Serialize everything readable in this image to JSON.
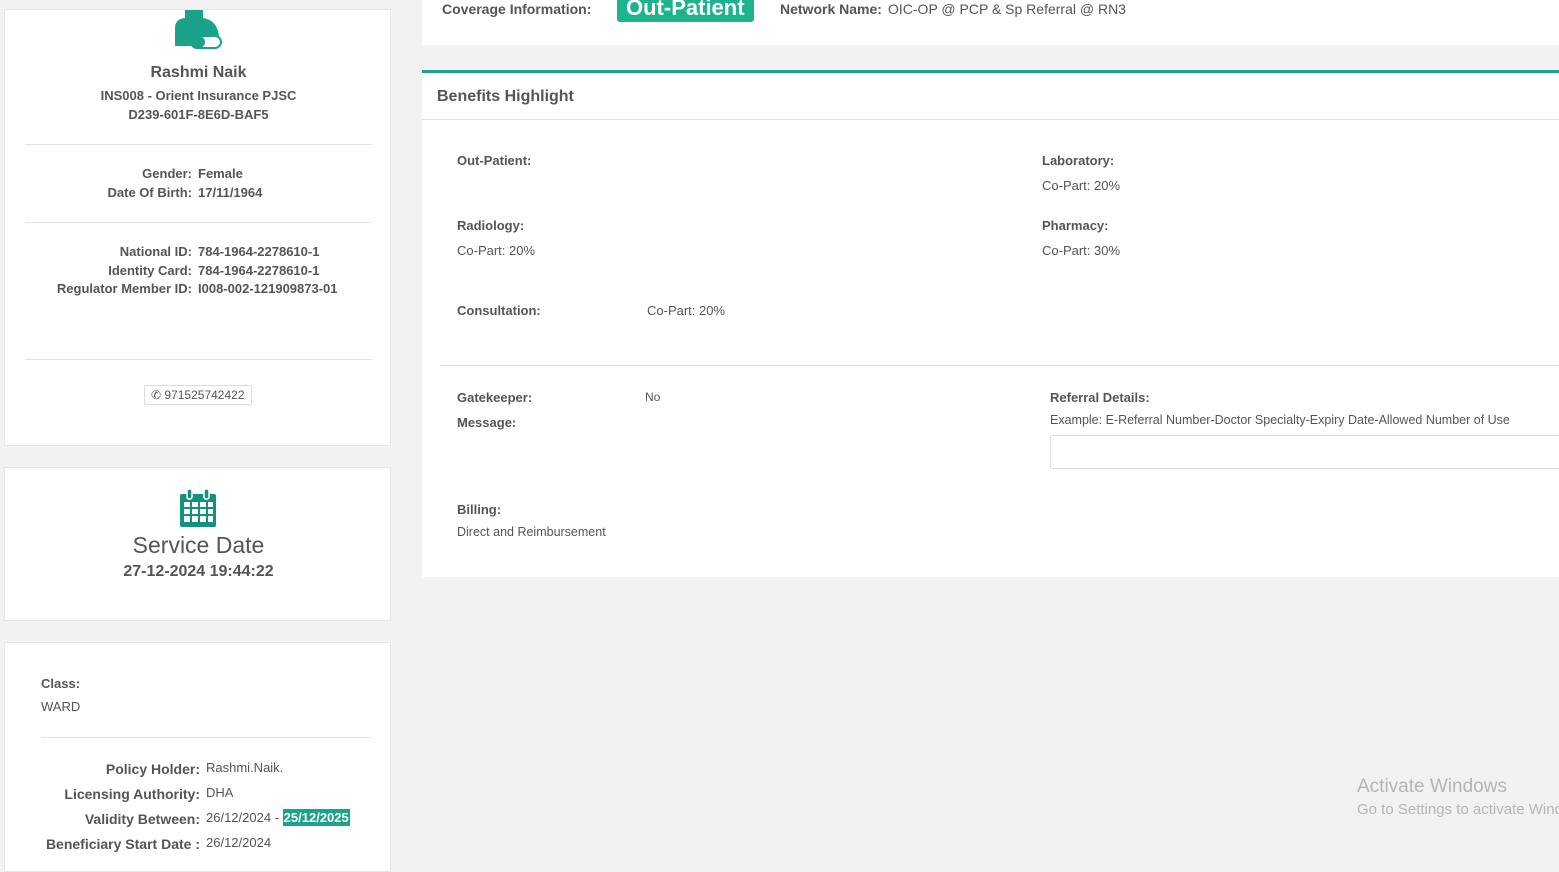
{
  "profile": {
    "name": "Rashmi Naik",
    "insurer": "INS008 - Orient Insurance PJSC",
    "member_code": "D239-601F-8E6D-BAF5",
    "gender_label": "Gender:",
    "gender": "Female",
    "dob_label": "Date Of Birth:",
    "dob": "17/11/1964",
    "national_id_label": "National ID:",
    "national_id": "784-1964-2278610-1",
    "identity_card_label": "Identity Card:",
    "identity_card": "784-1964-2278610-1",
    "regulator_label": "Regulator Member ID:",
    "regulator_id": "I008-002-121909873-01",
    "phone": "971525742422"
  },
  "service": {
    "title": "Service Date",
    "datetime": "27-12-2024 19:44:22"
  },
  "policy": {
    "class_label": "Class:",
    "class": "WARD",
    "holder_label": "Policy Holder:",
    "holder": "Rashmi.Naik.",
    "authority_label": "Licensing Authority:",
    "authority": "DHA",
    "validity_label": "Validity Between:",
    "validity_from": "26/12/2024",
    "validity_sep": "-",
    "validity_to": "25/12/2025",
    "start_label": "Beneficiary Start Date :",
    "start": "26/12/2024"
  },
  "coverage": {
    "label": "Coverage Information:",
    "badge": "Out-Patient",
    "network_label": "Network Name:",
    "network": "OIC-OP @ PCP & Sp Referral @ RN3"
  },
  "benefits": {
    "title": "Benefits Highlight",
    "out_patient_label": "Out-Patient:",
    "laboratory_label": "Laboratory:",
    "laboratory": "Co-Part: 20%",
    "radiology_label": "Radiology:",
    "radiology": "Co-Part: 20%",
    "pharmacy_label": "Pharmacy:",
    "pharmacy": "Co-Part: 30%",
    "consultation_label": "Consultation:",
    "consultation": "Co-Part: 20%",
    "gatekeeper_label": "Gatekeeper:",
    "gatekeeper": "No",
    "message_label": "Message:",
    "referral_label": "Referral Details:",
    "referral_example": "Example: E-Referral Number-Doctor Specialty-Expiry Date-Allowed Number of Use",
    "billing_label": "Billing:",
    "billing": "Direct and Reimbursement"
  },
  "watermark": {
    "title": "Activate Windows",
    "subtitle": "Go to Settings to activate Windows."
  },
  "colors": {
    "accent": "#1db38f",
    "teal": "#14907c"
  }
}
